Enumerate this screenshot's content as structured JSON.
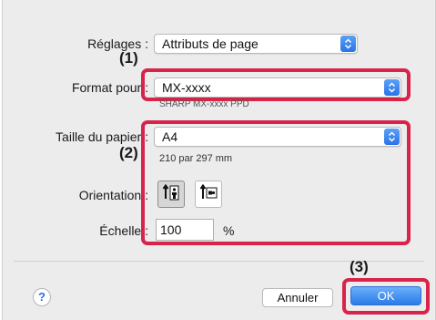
{
  "settings": {
    "label": "Réglages :",
    "value": "Attributs de page"
  },
  "format": {
    "label": "Format pour :",
    "value": "MX-xxxx",
    "subtext": "SHARP MX-xxxx PPD"
  },
  "paper": {
    "label": "Taille du papier :",
    "value": "A4",
    "dimensions": "210 par 297 mm"
  },
  "orientation": {
    "label": "Orientation :",
    "selected": "portrait"
  },
  "scale": {
    "label": "Échelle :",
    "value": "100",
    "unit": "%"
  },
  "steps": {
    "one": "(1)",
    "two": "(2)",
    "three": "(3)"
  },
  "buttons": {
    "help": "?",
    "cancel": "Annuler",
    "ok": "OK"
  },
  "colors": {
    "highlight": "#d8244a",
    "accent": "#2a7ae8"
  }
}
